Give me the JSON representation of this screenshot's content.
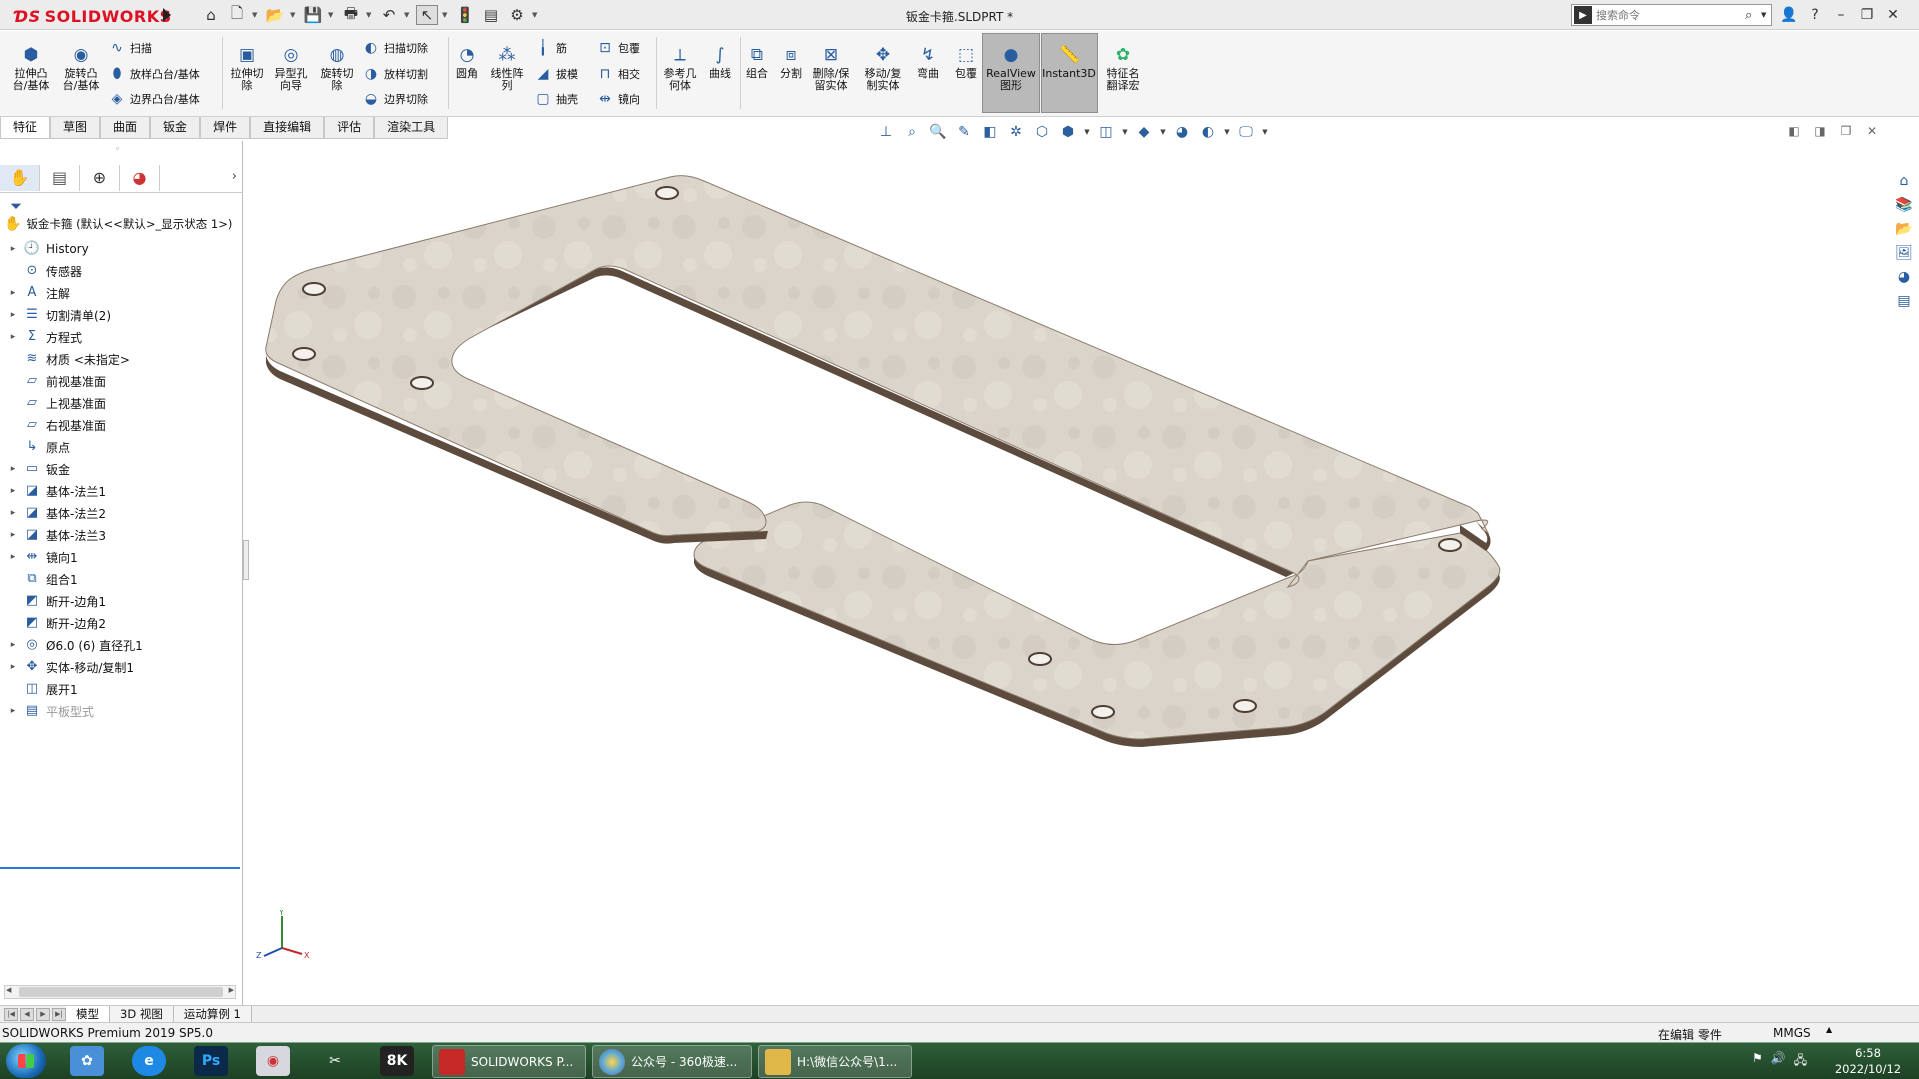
{
  "app": {
    "logo_text": "SOLIDWORKS",
    "document_title": "钣金卡箍.SLDPRT *",
    "search_placeholder": "搜索命令"
  },
  "ribbon": {
    "big_buttons": [
      {
        "label": "拉伸凸\n台/基体",
        "icon": "extrude-boss-icon"
      },
      {
        "label": "旋转凸\n台/基体",
        "icon": "revolve-boss-icon"
      },
      {
        "label": "拉伸切\n除",
        "icon": "extrude-cut-icon"
      },
      {
        "label": "异型孔\n向导",
        "icon": "hole-wizard-icon"
      },
      {
        "label": "旋转切\n除",
        "icon": "revolve-cut-icon"
      },
      {
        "label": "圆角",
        "icon": "fillet-icon"
      },
      {
        "label": "线性阵\n列",
        "icon": "linear-pattern-icon"
      },
      {
        "label": "参考几\n何体",
        "icon": "reference-geometry-icon"
      },
      {
        "label": "曲线",
        "icon": "curves-icon"
      },
      {
        "label": "组合",
        "icon": "combine-icon"
      },
      {
        "label": "分割",
        "icon": "split-icon"
      },
      {
        "label": "删除/保\n留实体",
        "icon": "delete-keep-body-icon"
      },
      {
        "label": "移动/复\n制实体",
        "icon": "move-copy-body-icon"
      },
      {
        "label": "弯曲",
        "icon": "flex-icon"
      },
      {
        "label": "包覆",
        "icon": "wrap-icon"
      },
      {
        "label": "RealView\n图形",
        "icon": "realview-icon"
      },
      {
        "label": "Instant3D",
        "icon": "instant3d-icon"
      },
      {
        "label": "特征名\n翻译宏",
        "icon": "macro-icon"
      }
    ],
    "small_buttons": {
      "sweep": "扫描",
      "loft": "放样凸台/基体",
      "boundary": "边界凸台/基体",
      "swept_cut": "扫描切除",
      "lofted_cut": "放样切割",
      "boundary_cut": "边界切除",
      "rib": "筋",
      "draft": "拔模",
      "shell": "抽壳",
      "wrap": "包覆",
      "intersect": "相交",
      "mirror": "镜向"
    }
  },
  "tabs": [
    "特征",
    "草图",
    "曲面",
    "钣金",
    "焊件",
    "直接编辑",
    "评估",
    "渲染工具"
  ],
  "tree": {
    "root": "钣金卡箍 (默认<<默认>_显示状态 1>)",
    "items": [
      {
        "label": "History",
        "icon": "history-icon",
        "expand": true
      },
      {
        "label": "传感器",
        "icon": "sensor-icon",
        "expand": false
      },
      {
        "label": "注解",
        "icon": "annotations-icon",
        "expand": true
      },
      {
        "label": "切割清单(2)",
        "icon": "cut-list-icon",
        "expand": true
      },
      {
        "label": "方程式",
        "icon": "equations-icon",
        "expand": true
      },
      {
        "label": "材质 <未指定>",
        "icon": "material-icon",
        "expand": false
      },
      {
        "label": "前视基准面",
        "icon": "plane-icon",
        "expand": false
      },
      {
        "label": "上视基准面",
        "icon": "plane-icon",
        "expand": false
      },
      {
        "label": "右视基准面",
        "icon": "plane-icon",
        "expand": false
      },
      {
        "label": "原点",
        "icon": "origin-icon",
        "expand": false
      },
      {
        "label": "钣金",
        "icon": "sheet-metal-icon",
        "expand": true
      },
      {
        "label": "基体-法兰1",
        "icon": "base-flange-icon",
        "expand": true
      },
      {
        "label": "基体-法兰2",
        "icon": "base-flange-icon",
        "expand": true
      },
      {
        "label": "基体-法兰3",
        "icon": "base-flange-icon",
        "expand": true
      },
      {
        "label": "镜向1",
        "icon": "mirror-icon",
        "expand": true
      },
      {
        "label": "组合1",
        "icon": "combine-icon",
        "expand": false
      },
      {
        "label": "断开-边角1",
        "icon": "break-corner-icon",
        "expand": false
      },
      {
        "label": "断开-边角2",
        "icon": "break-corner-icon",
        "expand": false
      },
      {
        "label": "Ø6.0 (6) 直径孔1",
        "icon": "hole-icon",
        "expand": true
      },
      {
        "label": "实体-移动/复制1",
        "icon": "move-copy-icon",
        "expand": true
      },
      {
        "label": "展开1",
        "icon": "unfold-icon",
        "expand": false
      },
      {
        "label": "平板型式",
        "icon": "flat-pattern-icon",
        "expand": true,
        "dim": true
      }
    ]
  },
  "bottom_tabs": [
    "模型",
    "3D 视图",
    "运动算例 1"
  ],
  "status": {
    "product": "SOLIDWORKS Premium 2019 SP5.0",
    "mode": "在编辑 零件",
    "units": "MMGS"
  },
  "taskbar": {
    "tasks": [
      {
        "label": "SOLIDWORKS P...",
        "color": "#c62828"
      },
      {
        "label": "公众号 - 360极速...",
        "color": "#4aa3df"
      },
      {
        "label": "H:\\微信公众号\\1...",
        "color": "#e0b84a"
      }
    ],
    "time": "6:58",
    "date": "2022/10/12"
  },
  "colors": {
    "accent": "#2a5d9f",
    "part_surface": "#d8d2c8",
    "part_edge": "#6e5c4e",
    "taskbar": "#2a5532"
  }
}
